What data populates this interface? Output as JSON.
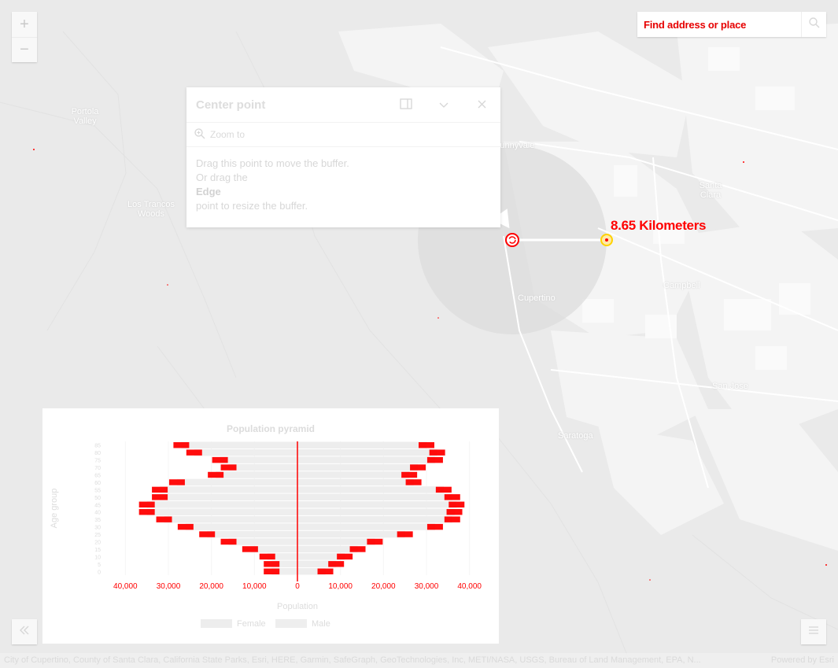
{
  "map": {
    "places": [
      {
        "name": "Sunnyvale"
      },
      {
        "name": "Santa Clara"
      },
      {
        "name": "Cupertino"
      },
      {
        "name": "Los Trancos Woods"
      },
      {
        "name": "Portola Valley"
      },
      {
        "name": "Saratoga"
      },
      {
        "name": "Campbell"
      },
      {
        "name": "San Jose"
      }
    ]
  },
  "zoom": {
    "in_label": "+",
    "out_label": "−"
  },
  "search": {
    "placeholder": "Find address or place"
  },
  "popup": {
    "title": "Center point",
    "zoom_to": "Zoom to",
    "line1": "Drag this point to move the buffer.",
    "line2": "Or drag the",
    "line3_bold": "Edge",
    "line4": "point to resize the buffer."
  },
  "buffer": {
    "distance_label": "8.65 Kilometers",
    "accent": "#ff0000"
  },
  "chart_data": {
    "type": "bar",
    "title": "Population pyramid",
    "xlabel": "Population",
    "ylabel": "Age group",
    "xlim": [
      -45000,
      45000
    ],
    "x_ticks": [
      "40,000",
      "30,000",
      "20,000",
      "10,000",
      "0",
      "10,000",
      "20,000",
      "30,000",
      "40,000"
    ],
    "categories": [
      "0",
      "5",
      "10",
      "15",
      "20",
      "25",
      "30",
      "35",
      "40",
      "45",
      "50",
      "55",
      "60",
      "65",
      "70",
      "75",
      "80",
      "85"
    ],
    "series": [
      {
        "name": "Female",
        "values": [
          6500,
          9000,
          11000,
          14000,
          18000,
          25000,
          32000,
          36000,
          36500,
          37000,
          36000,
          34000,
          27000,
          26000,
          28000,
          32000,
          32500,
          30000
        ]
      },
      {
        "name": "Male",
        "values": [
          -6000,
          -6000,
          -7000,
          -11000,
          -16000,
          -21000,
          -26000,
          -31000,
          -35000,
          -35000,
          -32000,
          -32000,
          -28000,
          -19000,
          -16000,
          -18000,
          -24000,
          -27000
        ]
      }
    ],
    "colors": {
      "female": "#ededed",
      "male": "#eeeeee",
      "accent": "#ff0000"
    },
    "legend": "bottom"
  },
  "attribution": {
    "text": "City of Cupertino, County of Santa Clara, California State Parks, Esri, HERE, Garmin, SafeGraph, GeoTechnologies, Inc, METI/NASA, USGS, Bureau of Land Management, EPA, N...",
    "powered": "Powered by Esri"
  },
  "icons": {
    "search": "search-icon",
    "dock": "dock-icon",
    "collapse": "chevron-down-icon",
    "close": "close-icon",
    "zoom_to": "zoom-to-icon",
    "panel_toggle": "double-chevron-left-icon",
    "menu": "hamburger-icon"
  }
}
